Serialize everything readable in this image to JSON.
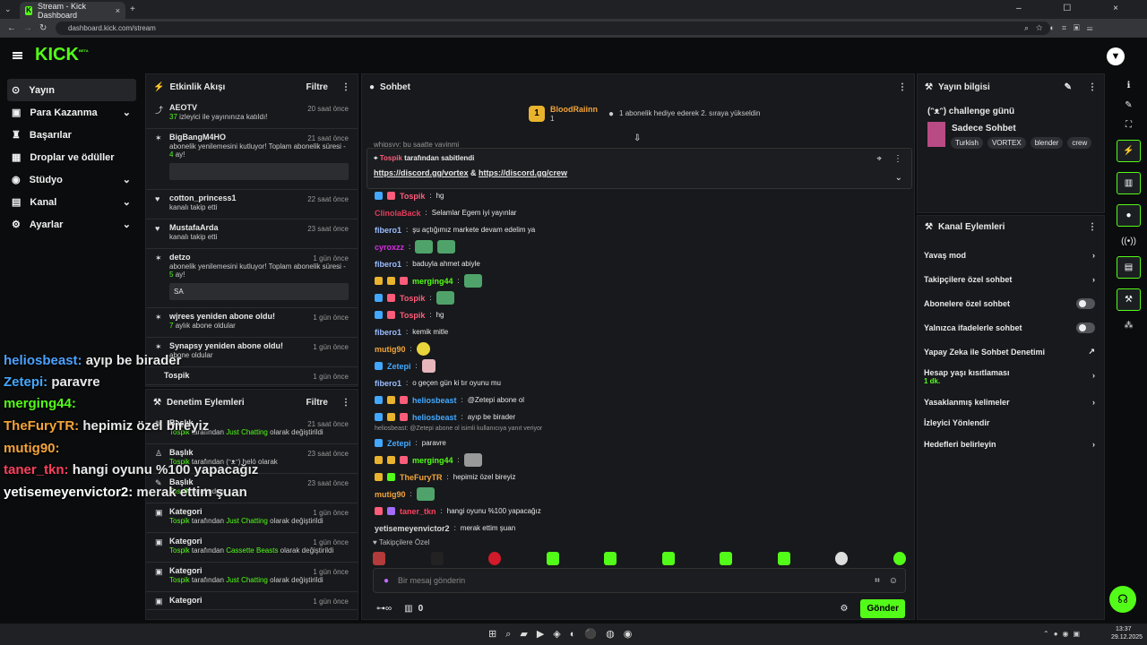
{
  "browser": {
    "tab_title": "Stream - Kick Dashboard",
    "url": "dashboard.kick.com/stream"
  },
  "kick": {
    "logo": "KICK",
    "logo_badge": "BETA"
  },
  "nav": {
    "items": [
      {
        "label": "Yayın",
        "icon": "live-icon"
      },
      {
        "label": "Para Kazanma",
        "icon": "money-icon"
      },
      {
        "label": "Başarılar",
        "icon": "trophy-icon"
      },
      {
        "label": "Droplar ve ödüller",
        "icon": "gift-icon"
      },
      {
        "label": "Stüdyo",
        "icon": "studio-icon"
      },
      {
        "label": "Kanal",
        "icon": "channel-icon"
      },
      {
        "label": "Ayarlar",
        "icon": "settings-icon"
      }
    ]
  },
  "activity": {
    "title": "Etkinlik Akışı",
    "filter": "Filtre",
    "items": [
      {
        "name": "AEOTV",
        "time": "20 saat önce",
        "count": "37",
        "text": "izleyici ile yayınınıza katıldı!"
      },
      {
        "name": "BigBangM4HO",
        "time": "21 saat önce",
        "text": "abonelik yenilemesini kutluyor! Toplam abonelik süresi",
        "count": "4",
        "count_suffix": "ay!"
      },
      {
        "name": "cotton_princess1",
        "time": "22 saat önce",
        "text": "kanalı takip etti"
      },
      {
        "name": "MustafaArda",
        "time": "23 saat önce",
        "text": "kanalı takip etti"
      },
      {
        "name": "detzo",
        "time": "1 gün önce",
        "text": "abonelik yenilemesini kutluyor! Toplam abonelik süresi",
        "count": "5",
        "count_suffix": "ay!",
        "message": "SA"
      },
      {
        "name": "wjrees yeniden abone oldu!",
        "time": "1 gün önce",
        "count": "7",
        "text": "aylık abone oldular"
      },
      {
        "name": "Synapsy yeniden abone oldu!",
        "time": "1 gün önce",
        "text": "abone oldular"
      },
      {
        "name": "Tospik",
        "time": "1 gün önce"
      }
    ]
  },
  "moderation": {
    "title": "Denetim Eylemleri",
    "filter": "Filtre",
    "items": [
      {
        "label": "Başlık",
        "time": "21 saat önce",
        "user": "Tospik",
        "text1": "tarafından",
        "value": "Just Chatting",
        "text2": "olarak değiştirildi"
      },
      {
        "label": "Başlık",
        "time": "23 saat önce",
        "user": "Tospik",
        "text1": "tarafından",
        "value": "(ᵔᴥᵔ) heló",
        "text2": "olarak"
      },
      {
        "label": "Başlık",
        "time": "23 saat önce",
        "user": "Tospik",
        "text1": "tarafından"
      },
      {
        "label": "Kategori",
        "time": "1 gün önce",
        "user": "Tospik",
        "text1": "tarafından",
        "value": "Just Chatting",
        "text2": "olarak değiştirildi"
      },
      {
        "label": "Kategori",
        "time": "1 gün önce",
        "user": "Tospik",
        "text1": "tarafından",
        "value": "Cassette Beasts",
        "text2": "olarak değiştirildi"
      },
      {
        "label": "Kategori",
        "time": "1 gün önce",
        "user": "Tospik",
        "text1": "tarafından",
        "value": "Just Chatting",
        "text2": "olarak değiştirildi"
      },
      {
        "label": "Kategori",
        "time": "1 gün önce"
      }
    ]
  },
  "chat": {
    "title": "Sohbet",
    "top_user": "BloodRaiinn",
    "top_sub": "1",
    "top_text": "1 abonelik hediye ederek 2. sıraya yükseldin",
    "pinned_user": "Tospik",
    "pinned_text": "tarafından sabitlendi",
    "pinned_link1": "https://discord.gg/vortex",
    "pinned_amp": "&",
    "pinned_link2": "https://discord.gg/crew",
    "partial_top": "whipsyy: bu saatte yayinmi",
    "messages": [
      {
        "user": "Tospik",
        "text": "hg",
        "color": "#ff5c7a"
      },
      {
        "user": "ClinolaBack",
        "text": "Selamlar Egem iyi yayınlar",
        "color": "#e43d5a"
      },
      {
        "user": "fibero1",
        "text": "şu açtığımız markete devam edelim ya",
        "color": "#9bbcff"
      },
      {
        "user": "cyroxzz",
        "text": "",
        "color": "#d52fe1"
      },
      {
        "user": "fibero1",
        "text": "baduyla ahmet abiyle",
        "color": "#9bbcff"
      },
      {
        "user": "merging44",
        "text": "",
        "color": "#53fc18"
      },
      {
        "user": "Tospik",
        "text": "",
        "color": "#ff5c7a"
      },
      {
        "user": "Tospik",
        "text": "hg",
        "color": "#ff5c7a"
      },
      {
        "user": "fibero1",
        "text": "kemik mitle",
        "color": "#9bbcff"
      },
      {
        "user": "mutig90",
        "text": "",
        "color": "#f3a43a"
      },
      {
        "user": "Zetepi",
        "text": "",
        "color": "#43a8ff"
      },
      {
        "user": "fibero1",
        "text": "o geçen gün ki tır oyunu mu",
        "color": "#9bbcff"
      },
      {
        "user": "heliosbeast",
        "text": "@Zetepi abone ol",
        "color": "#4ba1ff"
      },
      {
        "user": "heliosbeast",
        "text": "ayıp be birader",
        "color": "#4ba1ff"
      },
      {
        "user": "Zetepi",
        "text": "paravre",
        "color": "#43a8ff"
      },
      {
        "user": "merging44",
        "text": "",
        "color": "#53fc18"
      },
      {
        "user": "TheFuryTR",
        "text": "hepimiz özel bireyiz",
        "color": "#f3a43a"
      },
      {
        "user": "mutig90",
        "text": "",
        "color": "#f3a43a"
      },
      {
        "user": "taner_tkn",
        "text": "hangi oyunu %100 yapacağız",
        "color": "#ff3f5e"
      },
      {
        "user": "yetisemeyenvictor2",
        "text": "merak ettim şuan",
        "color": "#d9d9d9"
      }
    ],
    "reply_text": "heliosbeast: @Zetepi abone ol isimli kullanıcıya yanıt veriyor",
    "followers_only": "Takipçilere Özel",
    "input_placeholder": "Bir mesaj gönderin",
    "points": "0",
    "send": "Gönder"
  },
  "stream_info": {
    "title": "Yayın bilgisi",
    "headline": "(ᵔᴥᵔ) challenge günü",
    "category": "Sadece Sohbet",
    "tags": [
      "Turkish",
      "VORTEX",
      "blender",
      "crew"
    ]
  },
  "channel_actions": {
    "title": "Kanal Eylemleri",
    "items": [
      {
        "label": "Yavaş mod"
      },
      {
        "label": "Takipçilere özel sohbet"
      },
      {
        "label": "Abonelere özel sohbet"
      },
      {
        "label": "Yalnızca ifadelerle sohbet"
      },
      {
        "label": "Yapay Zeka ile Sohbet Denetimi"
      },
      {
        "label": "Hesap yaşı kısıtlaması",
        "sub": "1 dk."
      },
      {
        "label": "Yasaklanmış kelimeler"
      },
      {
        "label": "İzleyici Yönlendir"
      },
      {
        "label": "Hedefleri belirleyin"
      }
    ]
  },
  "overlay_chat": [
    {
      "user": "heliosbeast:",
      "text": "ayıp be birader",
      "color": "#4ba1ff"
    },
    {
      "user": "Zetepi:",
      "text": "paravre",
      "color": "#43a8ff"
    },
    {
      "user": "merging44:",
      "text": "",
      "color": "#53fc18"
    },
    {
      "user": "TheFuryTR:",
      "text": "hepimiz özel bireyiz",
      "color": "#f3a43a"
    },
    {
      "user": "mutig90:",
      "text": "",
      "color": "#f3a43a"
    },
    {
      "user": "taner_tkn:",
      "text": "hangi oyunu %100 yapacağız",
      "color": "#ff3f5e"
    },
    {
      "user": "yetisemeyenvictor2:",
      "text": "merak ettim şuan",
      "color": "#ffffff"
    }
  ],
  "taskbar": {
    "time": "13:37",
    "date": "29.12.2025"
  },
  "colors": {
    "accent": "#53fc18",
    "background": "#0b0c0d",
    "panel": "#17191c"
  }
}
